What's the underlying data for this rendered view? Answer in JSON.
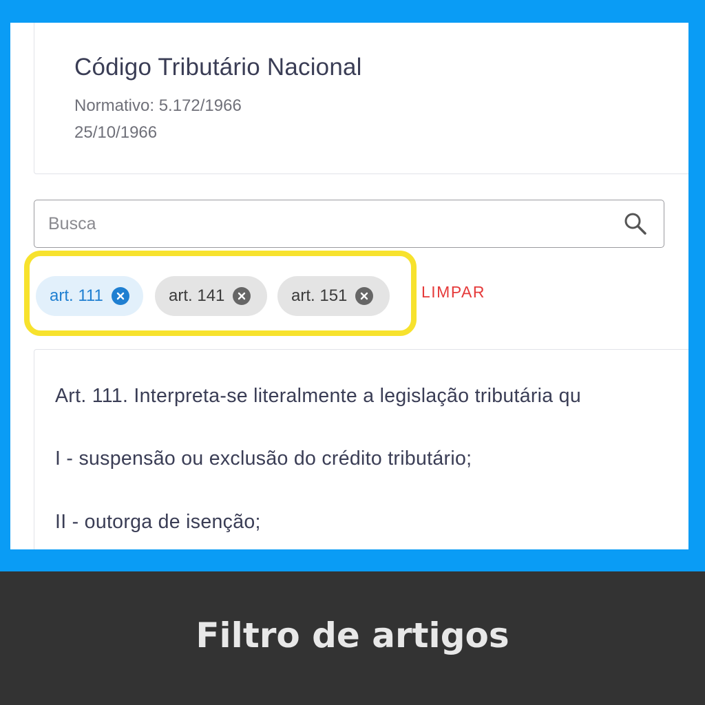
{
  "document": {
    "title": "Código Tributário Nacional",
    "normativo": "Normativo: 5.172/1966",
    "date": "25/10/1966"
  },
  "search": {
    "placeholder": "Busca",
    "icon": "search-icon"
  },
  "filters": {
    "chips": [
      {
        "label": "art. 111",
        "active": true
      },
      {
        "label": "art. 141",
        "active": false
      },
      {
        "label": "art. 151",
        "active": false
      }
    ],
    "clear_label": "LIMPAR"
  },
  "content": {
    "paragraphs": [
      "Art. 111. Interpreta-se literalmente a legislação tributária qu",
      "I - suspensão ou exclusão do crédito tributário;",
      "II - outorga de isenção;"
    ]
  },
  "caption": "Filtro de artigos",
  "colors": {
    "frame": "#0a9cf5",
    "highlight": "#f7e22d",
    "active_chip_text": "#1f7fd1",
    "clear_text": "#e53a3a",
    "caption_bar": "#333333"
  }
}
